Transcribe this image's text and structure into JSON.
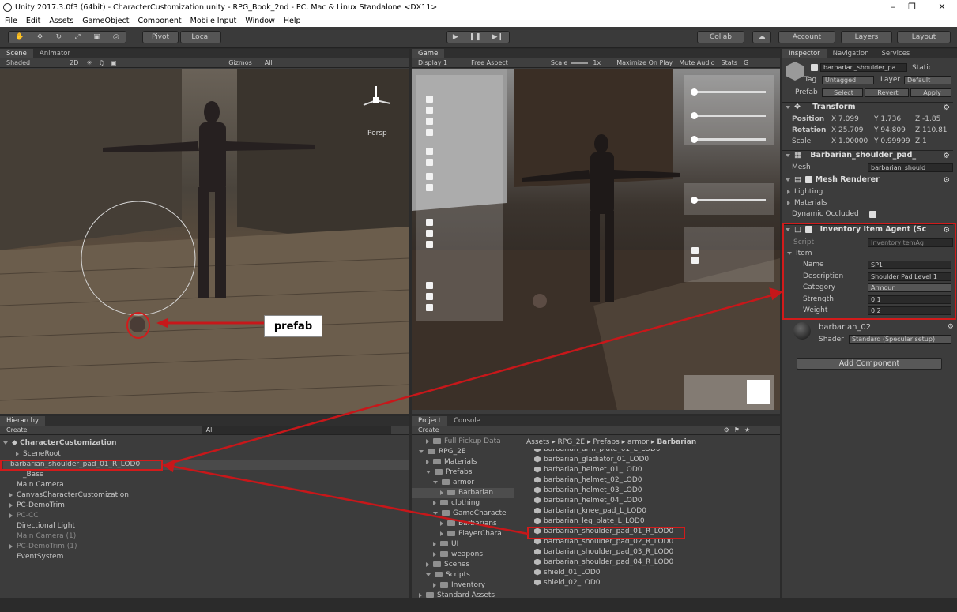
{
  "window": {
    "title": "Unity 2017.3.0f3 (64bit) - CharacterCustomization.unity - RPG_Book_2nd - PC, Mac & Linux Standalone <DX11>"
  },
  "menu": [
    "File",
    "Edit",
    "Assets",
    "GameObject",
    "Component",
    "Mobile Input",
    "Window",
    "Help"
  ],
  "toolbar": {
    "pivot": "Pivot",
    "local": "Local",
    "collab": "Collab",
    "account": "Account",
    "layers": "Layers",
    "layout": "Layout"
  },
  "scene": {
    "tab": "Scene",
    "tab2": "Animator",
    "shaded": "Shaded",
    "mode2d": "2D",
    "gizmos": "Gizmos",
    "search": "All",
    "persp": "Persp"
  },
  "game": {
    "tab": "Game",
    "display": "Display 1",
    "aspect": "Free Aspect",
    "scale": "Scale",
    "scale_val": "1x",
    "max": "Maximize On Play",
    "mute": "Mute Audio",
    "stats": "Stats",
    "gizmos": "G"
  },
  "callout": {
    "label": "prefab"
  },
  "hierarchy": {
    "tab": "Hierarchy",
    "create": "Create",
    "search": "All",
    "scene": "CharacterCustomization",
    "items": [
      {
        "label": "SceneRoot",
        "indent": 2,
        "arrow": true
      },
      {
        "label": "barbarian_shoulder_pad_01_R_LOD0",
        "indent": 1,
        "arrow": false
      },
      {
        "label": "_Base",
        "indent": 2,
        "arrow": false
      },
      {
        "label": "Main Camera",
        "indent": 1,
        "arrow": false
      },
      {
        "label": "CanvasCharacterCustomization",
        "indent": 1,
        "arrow": true
      },
      {
        "label": "PC-DemoTrim",
        "indent": 1,
        "arrow": true
      },
      {
        "label": "PC-CC",
        "indent": 1,
        "arrow": true,
        "dim": true
      },
      {
        "label": "Directional Light",
        "indent": 1,
        "arrow": false
      },
      {
        "label": "Main Camera (1)",
        "indent": 1,
        "arrow": false,
        "dim": true
      },
      {
        "label": "PC-DemoTrim (1)",
        "indent": 1,
        "arrow": true,
        "dim": true
      },
      {
        "label": "EventSystem",
        "indent": 1,
        "arrow": false
      }
    ]
  },
  "project": {
    "tab": "Project",
    "tab2": "Console",
    "create": "Create",
    "breadcrumb": [
      "Assets",
      "RPG_2E",
      "Prefabs",
      "armor",
      "Barbarian"
    ],
    "tree": [
      {
        "label": "Full Pickup Data",
        "indent": 2,
        "open": false
      },
      {
        "label": "RPG_2E",
        "indent": 1,
        "open": true
      },
      {
        "label": "Materials",
        "indent": 2,
        "open": false
      },
      {
        "label": "Prefabs",
        "indent": 2,
        "open": true
      },
      {
        "label": "armor",
        "indent": 3,
        "open": true
      },
      {
        "label": "Barbarian",
        "indent": 4,
        "open": false,
        "selected": true
      },
      {
        "label": "clothing",
        "indent": 3,
        "open": false
      },
      {
        "label": "GameCharacte",
        "indent": 3,
        "open": true
      },
      {
        "label": "Barbarians",
        "indent": 4,
        "open": false
      },
      {
        "label": "PlayerChara",
        "indent": 4,
        "open": false
      },
      {
        "label": "UI",
        "indent": 3,
        "open": false
      },
      {
        "label": "weapons",
        "indent": 3,
        "open": false
      },
      {
        "label": "Scenes",
        "indent": 2,
        "open": false
      },
      {
        "label": "Scripts",
        "indent": 2,
        "open": true
      },
      {
        "label": "Inventory",
        "indent": 3,
        "open": false
      },
      {
        "label": "Standard Assets",
        "indent": 1,
        "open": false
      }
    ],
    "files": [
      "barbarian_arm_plate_01_L_LOD0",
      "barbarian_gladiator_01_LOD0",
      "barbarian_helmet_01_LOD0",
      "barbarian_helmet_02_LOD0",
      "barbarian_helmet_03_LOD0",
      "barbarian_helmet_04_LOD0",
      "barbarian_knee_pad_L_LOD0",
      "barbarian_leg_plate_L_LOD0",
      "barbarian_shoulder_pad_01_R_LOD0",
      "barbarian_shoulder_pad_02_R_LOD0",
      "barbarian_shoulder_pad_03_R_LOD0",
      "barbarian_shoulder_pad_04_R_LOD0",
      "shield_01_LOD0",
      "shield_02_LOD0"
    ]
  },
  "inspector": {
    "tab": "Inspector",
    "tab2": "Navigation",
    "tab3": "Services",
    "name": "barbarian_shoulder_pa",
    "static": "Static",
    "tag_label": "Tag",
    "tag": "Untagged",
    "layer_label": "Layer",
    "layer": "Default",
    "prefab_label": "Prefab",
    "select": "Select",
    "revert": "Revert",
    "apply": "Apply",
    "transform": {
      "title": "Transform",
      "position": {
        "label": "Position",
        "x": "X 7.099",
        "y": "Y 1.736",
        "z": "Z -1.85"
      },
      "rotation": {
        "label": "Rotation",
        "x": "X 25.709",
        "y": "Y 94.809",
        "z": "Z 110.81"
      },
      "scale": {
        "label": "Scale",
        "x": "X 1.00000",
        "y": "Y 0.99999",
        "z": "Z 1"
      }
    },
    "meshfilter": {
      "title": "Barbarian_shoulder_pad_",
      "mesh_label": "Mesh",
      "mesh": "barbarian_should"
    },
    "meshrenderer": {
      "title": "Mesh Renderer",
      "lighting": "Lighting",
      "materials": "Materials",
      "dynamic": "Dynamic Occluded"
    },
    "agent": {
      "title": "Inventory Item Agent (Sc",
      "script_label": "Script",
      "script": "InventoryItemAg",
      "item": "Item",
      "fields": [
        {
          "label": "Name",
          "value": "SP1"
        },
        {
          "label": "Description",
          "value": "Shoulder Pad Level 1"
        },
        {
          "label": "Category",
          "value": "Armour"
        },
        {
          "label": "Strength",
          "value": "0.1"
        },
        {
          "label": "Weight",
          "value": "0.2"
        }
      ]
    },
    "material": {
      "title": "barbarian_02",
      "shader_label": "Shader",
      "shader": "Standard (Specular setup)"
    },
    "add_component": "Add Component"
  }
}
